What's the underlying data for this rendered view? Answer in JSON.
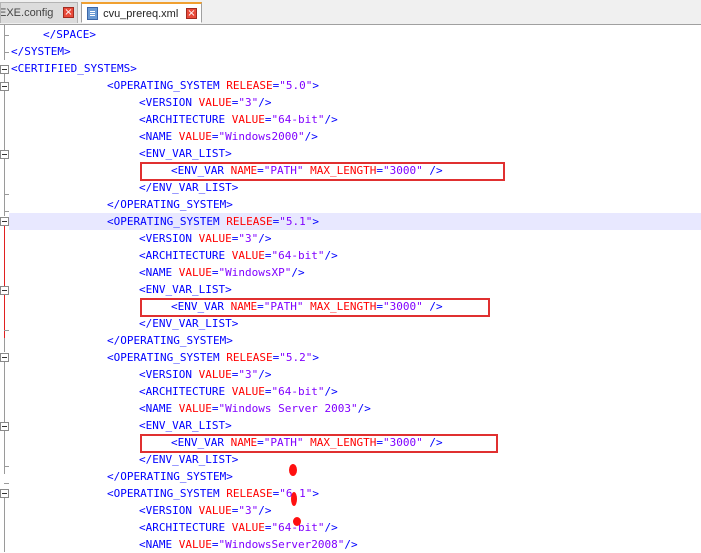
{
  "tabs": [
    {
      "label": "EXE.config",
      "active": false
    },
    {
      "label": "cvu_prereq.xml",
      "active": true
    }
  ],
  "code_lines": [
    {
      "indent": 4,
      "parts": [
        [
          "t",
          "</SPACE>"
        ]
      ]
    },
    {
      "indent": 0,
      "parts": [
        [
          "t",
          "</SYSTEM>"
        ]
      ]
    },
    {
      "indent": 0,
      "parts": [
        [
          "t",
          "<CERTIFIED_SYSTEMS>"
        ]
      ]
    },
    {
      "indent": 12,
      "parts": [
        [
          "t",
          "<OPERATING_SYSTEM "
        ],
        [
          "a",
          "RELEASE"
        ],
        [
          "t",
          "="
        ],
        [
          "v",
          "\"5.0\""
        ],
        [
          "t",
          ">"
        ]
      ]
    },
    {
      "indent": 16,
      "parts": [
        [
          "t",
          "<VERSION "
        ],
        [
          "a",
          "VALUE"
        ],
        [
          "t",
          "="
        ],
        [
          "v",
          "\"3\""
        ],
        [
          "t",
          "/>"
        ]
      ]
    },
    {
      "indent": 16,
      "parts": [
        [
          "t",
          "<ARCHITECTURE "
        ],
        [
          "a",
          "VALUE"
        ],
        [
          "t",
          "="
        ],
        [
          "v",
          "\"64-bit\""
        ],
        [
          "t",
          "/>"
        ]
      ]
    },
    {
      "indent": 16,
      "parts": [
        [
          "t",
          "<NAME "
        ],
        [
          "a",
          "VALUE"
        ],
        [
          "t",
          "="
        ],
        [
          "v",
          "\"Windows2000\""
        ],
        [
          "t",
          "/>"
        ]
      ]
    },
    {
      "indent": 16,
      "parts": [
        [
          "t",
          "<ENV_VAR_LIST>"
        ]
      ]
    },
    {
      "indent": 20,
      "parts": [
        [
          "t",
          "<ENV_VAR "
        ],
        [
          "a",
          "NAME"
        ],
        [
          "t",
          "="
        ],
        [
          "v",
          "\"PATH\""
        ],
        [
          "t",
          " "
        ],
        [
          "a",
          "MAX_LENGTH"
        ],
        [
          "t",
          "="
        ],
        [
          "v",
          "\"3000\""
        ],
        [
          "t",
          " />"
        ]
      ]
    },
    {
      "indent": 16,
      "parts": [
        [
          "t",
          "</ENV_VAR_LIST>"
        ]
      ]
    },
    {
      "indent": 12,
      "parts": [
        [
          "t",
          "</OPERATING_SYSTEM>"
        ]
      ]
    },
    {
      "indent": 12,
      "parts": [
        [
          "t",
          "<OPERATING_SYSTEM "
        ],
        [
          "a",
          "RELEASE"
        ],
        [
          "t",
          "="
        ],
        [
          "v",
          "\"5.1\""
        ],
        [
          "t",
          ">"
        ]
      ],
      "current": true
    },
    {
      "indent": 16,
      "parts": [
        [
          "t",
          "<VERSION "
        ],
        [
          "a",
          "VALUE"
        ],
        [
          "t",
          "="
        ],
        [
          "v",
          "\"3\""
        ],
        [
          "t",
          "/>"
        ]
      ]
    },
    {
      "indent": 16,
      "parts": [
        [
          "t",
          "<ARCHITECTURE "
        ],
        [
          "a",
          "VALUE"
        ],
        [
          "t",
          "="
        ],
        [
          "v",
          "\"64-bit\""
        ],
        [
          "t",
          "/>"
        ]
      ]
    },
    {
      "indent": 16,
      "parts": [
        [
          "t",
          "<NAME "
        ],
        [
          "a",
          "VALUE"
        ],
        [
          "t",
          "="
        ],
        [
          "v",
          "\"WindowsXP\""
        ],
        [
          "t",
          "/>"
        ]
      ]
    },
    {
      "indent": 16,
      "parts": [
        [
          "t",
          "<ENV_VAR_LIST>"
        ]
      ]
    },
    {
      "indent": 20,
      "parts": [
        [
          "t",
          "<ENV_VAR "
        ],
        [
          "a",
          "NAME"
        ],
        [
          "t",
          "="
        ],
        [
          "v",
          "\"PATH\""
        ],
        [
          "t",
          " "
        ],
        [
          "a",
          "MAX_LENGTH"
        ],
        [
          "t",
          "="
        ],
        [
          "v",
          "\"3000\""
        ],
        [
          "t",
          " />"
        ]
      ]
    },
    {
      "indent": 16,
      "parts": [
        [
          "t",
          "</ENV_VAR_LIST>"
        ]
      ]
    },
    {
      "indent": 12,
      "parts": [
        [
          "t",
          "</OPERATING_SYSTEM>"
        ]
      ]
    },
    {
      "indent": 12,
      "parts": [
        [
          "t",
          "<OPERATING_SYSTEM "
        ],
        [
          "a",
          "RELEASE"
        ],
        [
          "t",
          "="
        ],
        [
          "v",
          "\"5.2\""
        ],
        [
          "t",
          ">"
        ]
      ]
    },
    {
      "indent": 16,
      "parts": [
        [
          "t",
          "<VERSION "
        ],
        [
          "a",
          "VALUE"
        ],
        [
          "t",
          "="
        ],
        [
          "v",
          "\"3\""
        ],
        [
          "t",
          "/>"
        ]
      ]
    },
    {
      "indent": 16,
      "parts": [
        [
          "t",
          "<ARCHITECTURE "
        ],
        [
          "a",
          "VALUE"
        ],
        [
          "t",
          "="
        ],
        [
          "v",
          "\"64-bit\""
        ],
        [
          "t",
          "/>"
        ]
      ]
    },
    {
      "indent": 16,
      "parts": [
        [
          "t",
          "<NAME "
        ],
        [
          "a",
          "VALUE"
        ],
        [
          "t",
          "="
        ],
        [
          "v",
          "\"Windows Server 2003\""
        ],
        [
          "t",
          "/>"
        ]
      ]
    },
    {
      "indent": 16,
      "parts": [
        [
          "t",
          "<ENV_VAR_LIST>"
        ]
      ]
    },
    {
      "indent": 20,
      "parts": [
        [
          "t",
          "<ENV_VAR "
        ],
        [
          "a",
          "NAME"
        ],
        [
          "t",
          "="
        ],
        [
          "v",
          "\"PATH\""
        ],
        [
          "t",
          " "
        ],
        [
          "a",
          "MAX_LENGTH"
        ],
        [
          "t",
          "="
        ],
        [
          "v",
          "\"3000\""
        ],
        [
          "t",
          " />"
        ]
      ]
    },
    {
      "indent": 16,
      "parts": [
        [
          "t",
          "</ENV_VAR_LIST>"
        ]
      ]
    },
    {
      "indent": 12,
      "parts": [
        [
          "t",
          "</OPERATING_SYSTEM>"
        ]
      ]
    },
    {
      "indent": 12,
      "parts": [
        [
          "t",
          "<OPERATING_SYSTEM "
        ],
        [
          "a",
          "RELEASE"
        ],
        [
          "t",
          "="
        ],
        [
          "v",
          "\"6.1\""
        ],
        [
          "t",
          ">"
        ]
      ]
    },
    {
      "indent": 16,
      "parts": [
        [
          "t",
          "<VERSION "
        ],
        [
          "a",
          "VALUE"
        ],
        [
          "t",
          "="
        ],
        [
          "v",
          "\"3\""
        ],
        [
          "t",
          "/>"
        ]
      ]
    },
    {
      "indent": 16,
      "parts": [
        [
          "t",
          "<ARCHITECTURE "
        ],
        [
          "a",
          "VALUE"
        ],
        [
          "t",
          "="
        ],
        [
          "v",
          "\"64-bit\""
        ],
        [
          "t",
          "/>"
        ]
      ]
    },
    {
      "indent": 16,
      "parts": [
        [
          "t",
          "<NAME "
        ],
        [
          "a",
          "VALUE"
        ],
        [
          "t",
          "="
        ],
        [
          "v",
          "\"WindowsServer2008\""
        ],
        [
          "t",
          "/>"
        ]
      ]
    }
  ],
  "highlighted_lines": [
    8,
    16,
    24
  ],
  "colors": {
    "tag": "#0000ff",
    "attribute": "#ff0000",
    "value": "#8000ff",
    "highlight_box": "#e03030",
    "current_line": "#e8e8ff"
  }
}
